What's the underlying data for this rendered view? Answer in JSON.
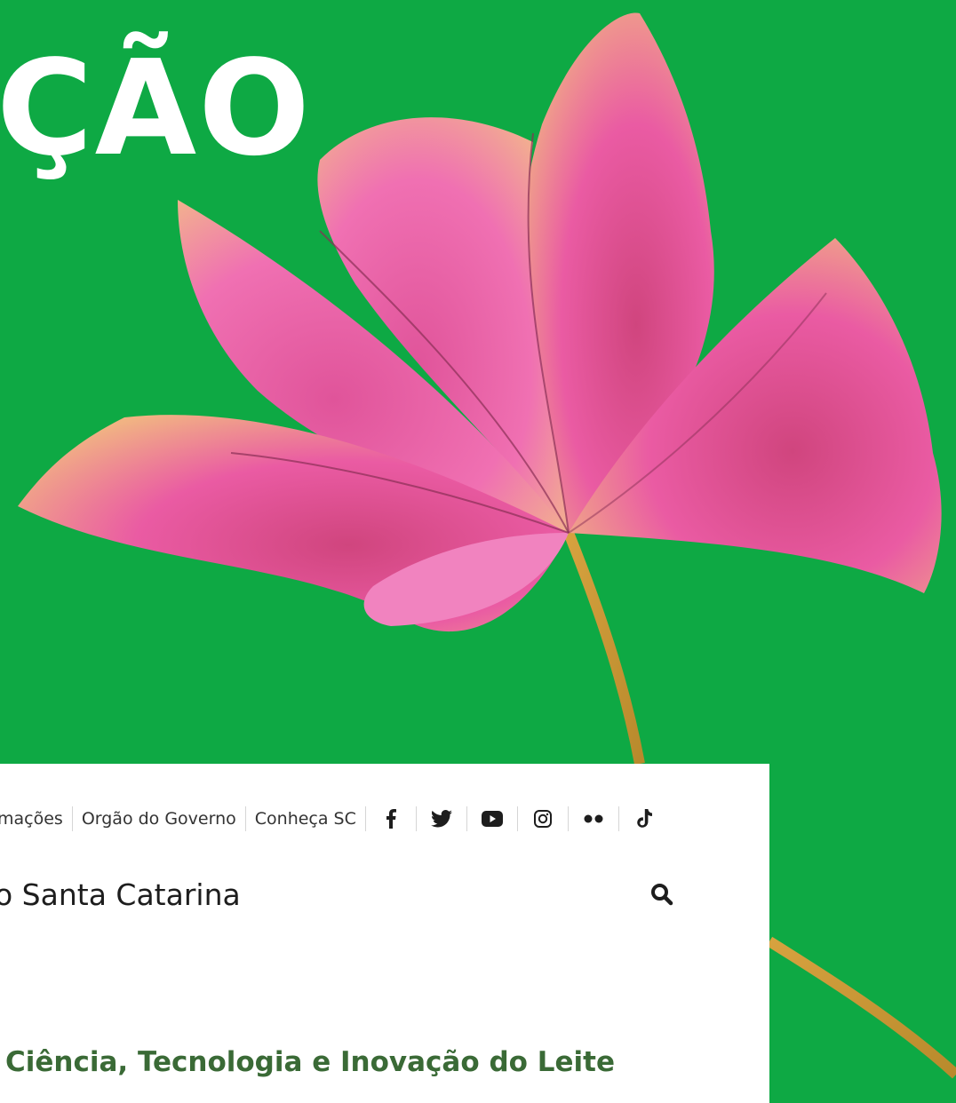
{
  "hero": {
    "title": "ÇÃO"
  },
  "topbar": {
    "links": [
      "mações",
      "Orgão do Governo",
      "Conheça SC"
    ],
    "social_icons": [
      "facebook-icon",
      "twitter-icon",
      "youtube-icon",
      "instagram-icon",
      "flickr-icon",
      "tiktok-icon"
    ]
  },
  "header": {
    "site_title": "o Santa Catarina",
    "search_icon": "search-icon"
  },
  "main": {
    "heading": "Ciência, Tecnologia e Inovação do Leite"
  },
  "colors": {
    "background": "#0ea944",
    "card": "#ffffff",
    "heading": "#3a6a36",
    "petal": "#e7559d",
    "stem": "#d9a53a"
  }
}
